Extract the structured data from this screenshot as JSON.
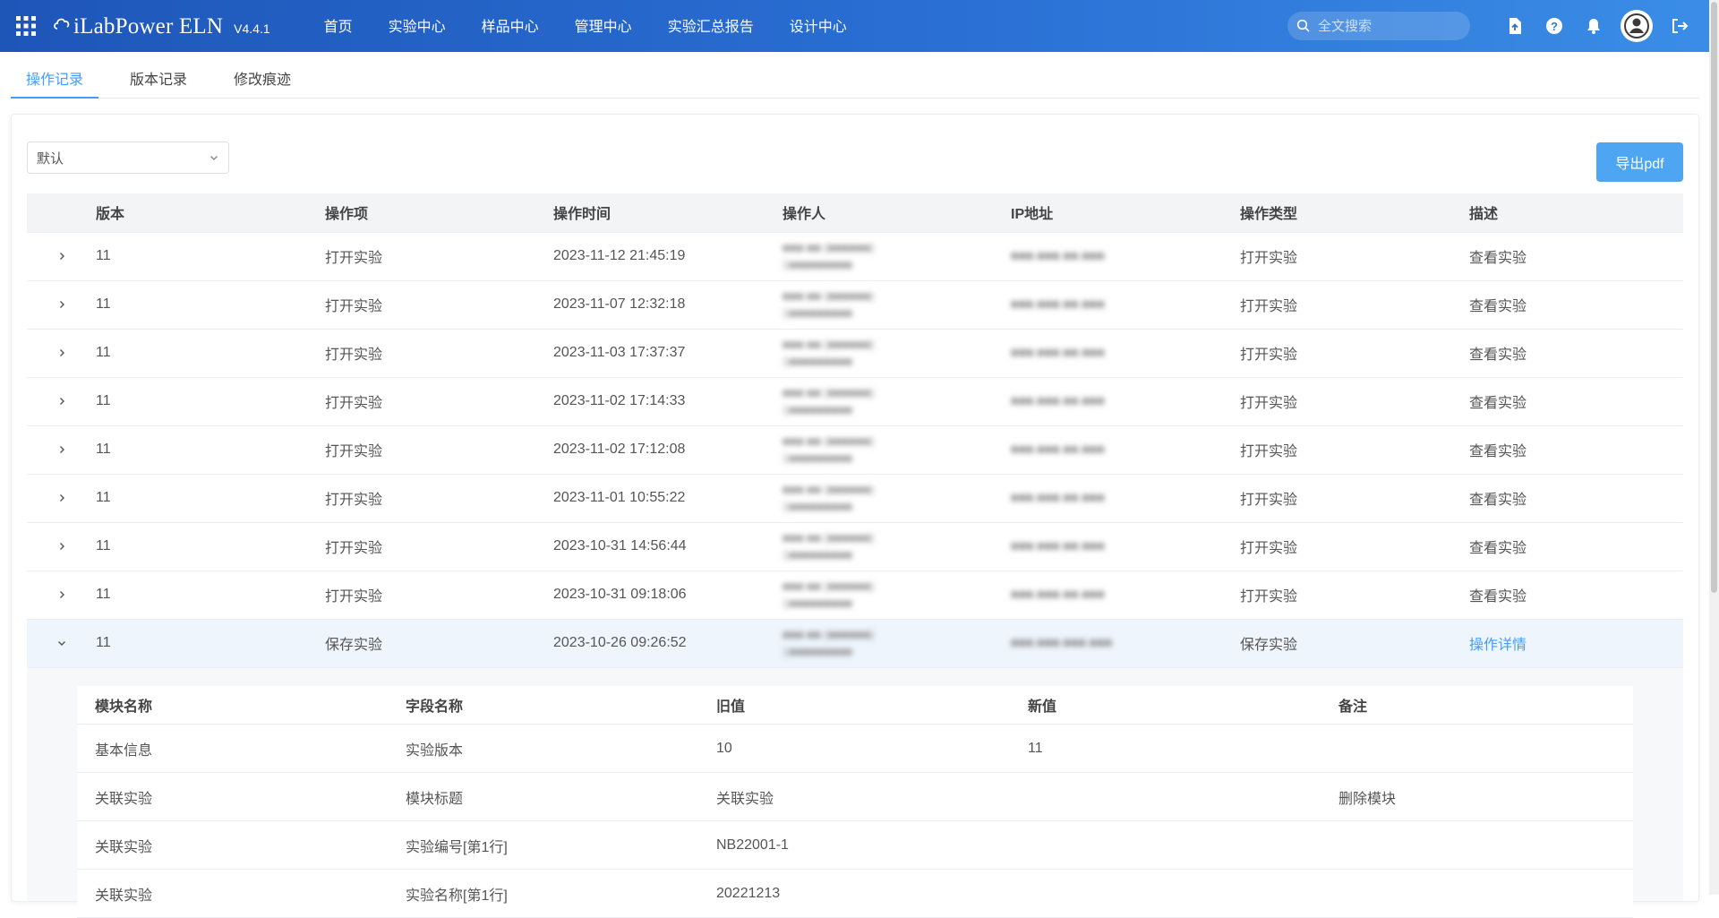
{
  "header": {
    "brand_name": "iLabPower ELN",
    "version": "V4.4.1",
    "nav": [
      "首页",
      "实验中心",
      "样品中心",
      "管理中心",
      "实验汇总报告",
      "设计中心"
    ],
    "search_placeholder": "全文搜索"
  },
  "tabs": [
    "操作记录",
    "版本记录",
    "修改痕迹"
  ],
  "filter": {
    "selected": "默认"
  },
  "export_label": "导出pdf",
  "table": {
    "columns": [
      "版本",
      "操作项",
      "操作时间",
      "操作人",
      "IP地址",
      "操作类型",
      "描述"
    ],
    "rows": [
      {
        "version": "11",
        "item": "打开实验",
        "time": "2023-11-12 21:45:19",
        "operator": "■■■ ■■ (■■■■■■)",
        "operator_sub": "1■■■■■■■■■",
        "ip": "■■■.■■■.■■.■■■",
        "type": "打开实验",
        "desc": "查看实验"
      },
      {
        "version": "11",
        "item": "打开实验",
        "time": "2023-11-07 12:32:18",
        "operator": "■■■ ■■ (■■■■■■)",
        "operator_sub": "1■■■■■■■■■",
        "ip": "■■■.■■■.■■.■■■",
        "type": "打开实验",
        "desc": "查看实验"
      },
      {
        "version": "11",
        "item": "打开实验",
        "time": "2023-11-03 17:37:37",
        "operator": "■■■ ■■ (■■■■■■)",
        "operator_sub": "1■■■■■■■■■",
        "ip": "■■■.■■■.■■.■■■",
        "type": "打开实验",
        "desc": "查看实验"
      },
      {
        "version": "11",
        "item": "打开实验",
        "time": "2023-11-02 17:14:33",
        "operator": "■■■ ■■ (■■■■■■)",
        "operator_sub": "1■■■■■■■■■",
        "ip": "■■■.■■■.■■.■■■",
        "type": "打开实验",
        "desc": "查看实验"
      },
      {
        "version": "11",
        "item": "打开实验",
        "time": "2023-11-02 17:12:08",
        "operator": "■■■ ■■ (■■■■■■)",
        "operator_sub": "1■■■■■■■■■",
        "ip": "■■■.■■■.■■.■■■",
        "type": "打开实验",
        "desc": "查看实验"
      },
      {
        "version": "11",
        "item": "打开实验",
        "time": "2023-11-01 10:55:22",
        "operator": "■■■ ■■ (■■■■■■)",
        "operator_sub": "1■■■■■■■■■",
        "ip": "■■■.■■■.■■.■■■",
        "type": "打开实验",
        "desc": "查看实验"
      },
      {
        "version": "11",
        "item": "打开实验",
        "time": "2023-10-31 14:56:44",
        "operator": "■■■ ■■ (■■■■■■)",
        "operator_sub": "1■■■■■■■■■",
        "ip": "■■■.■■■.■■.■■■",
        "type": "打开实验",
        "desc": "查看实验"
      },
      {
        "version": "11",
        "item": "打开实验",
        "time": "2023-10-31 09:18:06",
        "operator": "■■■ ■■ (■■■■■■)",
        "operator_sub": "1■■■■■■■■■",
        "ip": "■■■.■■■.■■.■■■",
        "type": "打开实验",
        "desc": "查看实验"
      },
      {
        "version": "11",
        "item": "保存实验",
        "time": "2023-10-26 09:26:52",
        "operator": "■■■ ■■ (■■■■■■)",
        "operator_sub": "1■■■■■■■■■",
        "ip": "■■■.■■■.■■■.■■■",
        "type": "保存实验",
        "desc": "操作详情"
      }
    ]
  },
  "detail": {
    "columns": [
      "模块名称",
      "字段名称",
      "旧值",
      "新值",
      "备注"
    ],
    "rows": [
      {
        "module": "基本信息",
        "field": "实验版本",
        "old": "10",
        "new": "11",
        "note": ""
      },
      {
        "module": "关联实验",
        "field": "模块标题",
        "old": "关联实验",
        "new": "",
        "note": "删除模块"
      },
      {
        "module": "关联实验",
        "field": "实验编号[第1行]",
        "old": "NB22001-1",
        "new": "",
        "note": ""
      },
      {
        "module": "关联实验",
        "field": "实验名称[第1行]",
        "old": "20221213",
        "new": "",
        "note": ""
      }
    ]
  }
}
